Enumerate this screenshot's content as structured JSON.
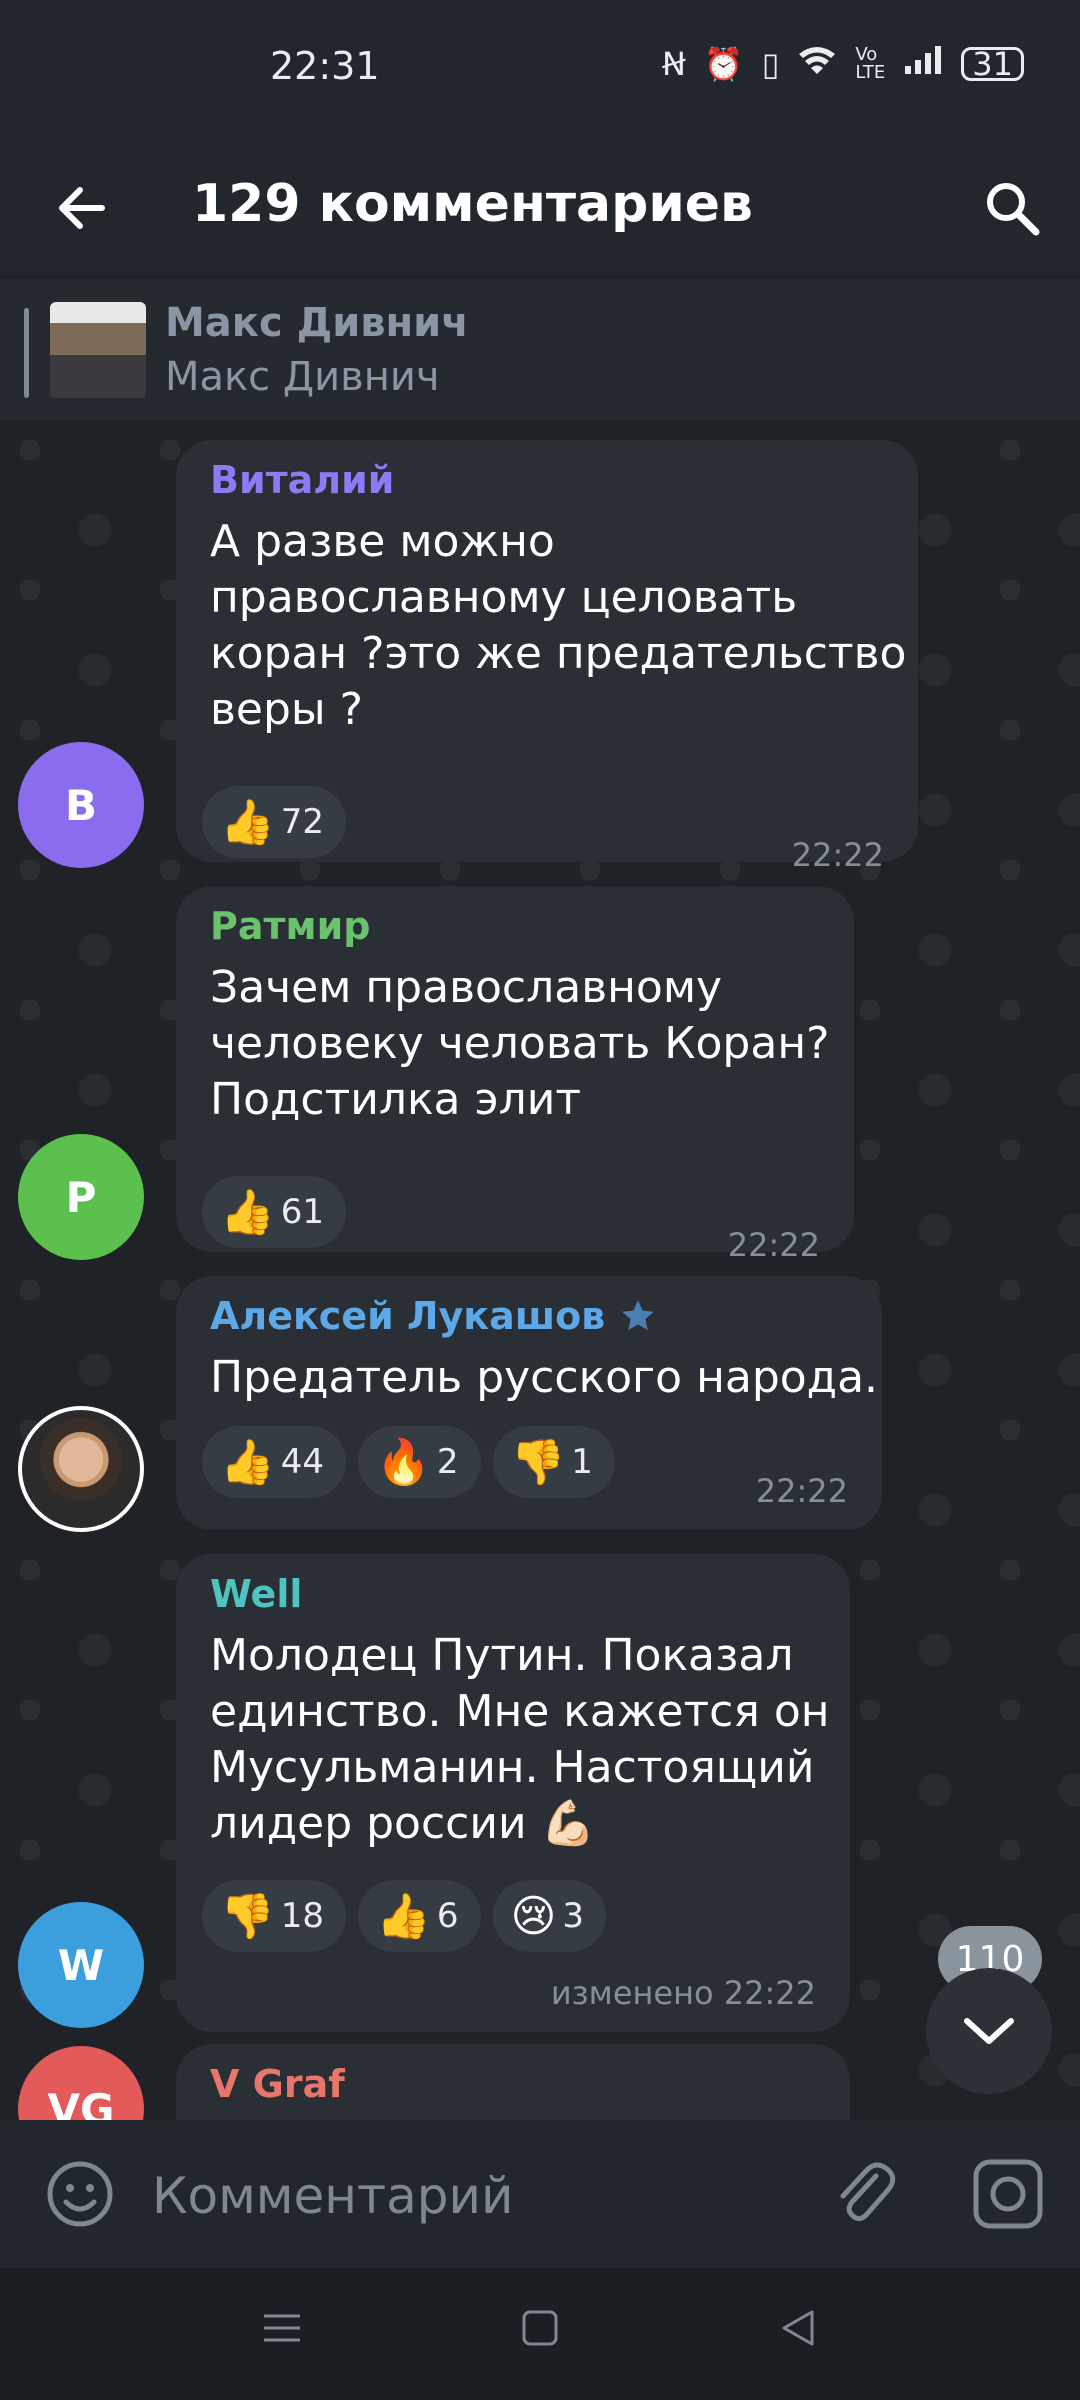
{
  "status_bar": {
    "time": "22:31",
    "battery": "31",
    "icons": [
      "nfc-icon",
      "alarm-icon",
      "vibrate-icon",
      "wifi-icon",
      "volte-icon",
      "signal-icon",
      "battery-icon"
    ]
  },
  "header": {
    "title": "129 комментариев",
    "back_icon": "arrow-left-icon",
    "search_icon": "search-icon"
  },
  "pinned": {
    "name": "Макс Дивнич",
    "subtitle": "Макс Дивнич"
  },
  "comments": [
    {
      "author": "Виталий",
      "author_color": "#8a7cf5",
      "avatar_letter": "В",
      "avatar_color": "#8b6cef",
      "text_lines": [
        "А разве можно",
        "православному целовать",
        "коран ?это же предательство",
        "веры ?"
      ],
      "reactions": [
        {
          "emoji": "👍",
          "count": "72"
        }
      ],
      "time": "22:22"
    },
    {
      "author": "Ратмир",
      "author_color": "#6ac36c",
      "avatar_letter": "Р",
      "avatar_color": "#5cc04f",
      "text_lines": [
        "Зачем православному",
        "человеку человать Коран?",
        "Подстилка элит"
      ],
      "reactions": [
        {
          "emoji": "👍",
          "count": "61"
        }
      ],
      "time": "22:22"
    },
    {
      "author": "Алексей Лукашов",
      "author_color": "#5ea8e8",
      "badge_icon": "star-icon",
      "text_lines": [
        "Предатель русского народа."
      ],
      "reactions": [
        {
          "emoji": "👍",
          "count": "44"
        },
        {
          "emoji": "🔥",
          "count": "2"
        },
        {
          "emoji": "👎",
          "count": "1"
        }
      ],
      "time": "22:22"
    },
    {
      "author": "Well",
      "author_color": "#4fc3c0",
      "avatar_letter": "W",
      "avatar_color": "#3a9fdc",
      "text_lines": [
        "Молодец Путин. Показал",
        "единство. Мне кажется он",
        "Мусульманин. Настоящий",
        "лидер россии 💪🏻"
      ],
      "reactions": [
        {
          "emoji": "👎",
          "count": "18"
        },
        {
          "emoji": "👍",
          "count": "6"
        },
        {
          "emoji": "😢",
          "count": "3"
        }
      ],
      "time": "изменено 22:22"
    },
    {
      "author": "V Graf",
      "author_color": "#e8766a",
      "avatar_letter": "VG",
      "avatar_color": "#e25a5a"
    }
  ],
  "scroll": {
    "unread_count": "110",
    "icon": "chevron-down-icon"
  },
  "input": {
    "placeholder": "Комментарий",
    "emoji_icon": "smile-icon",
    "attach_icon": "paperclip-icon",
    "camera_icon": "instagram-camera-icon"
  },
  "navigation": [
    "menu-icon",
    "home-icon",
    "back-icon"
  ]
}
